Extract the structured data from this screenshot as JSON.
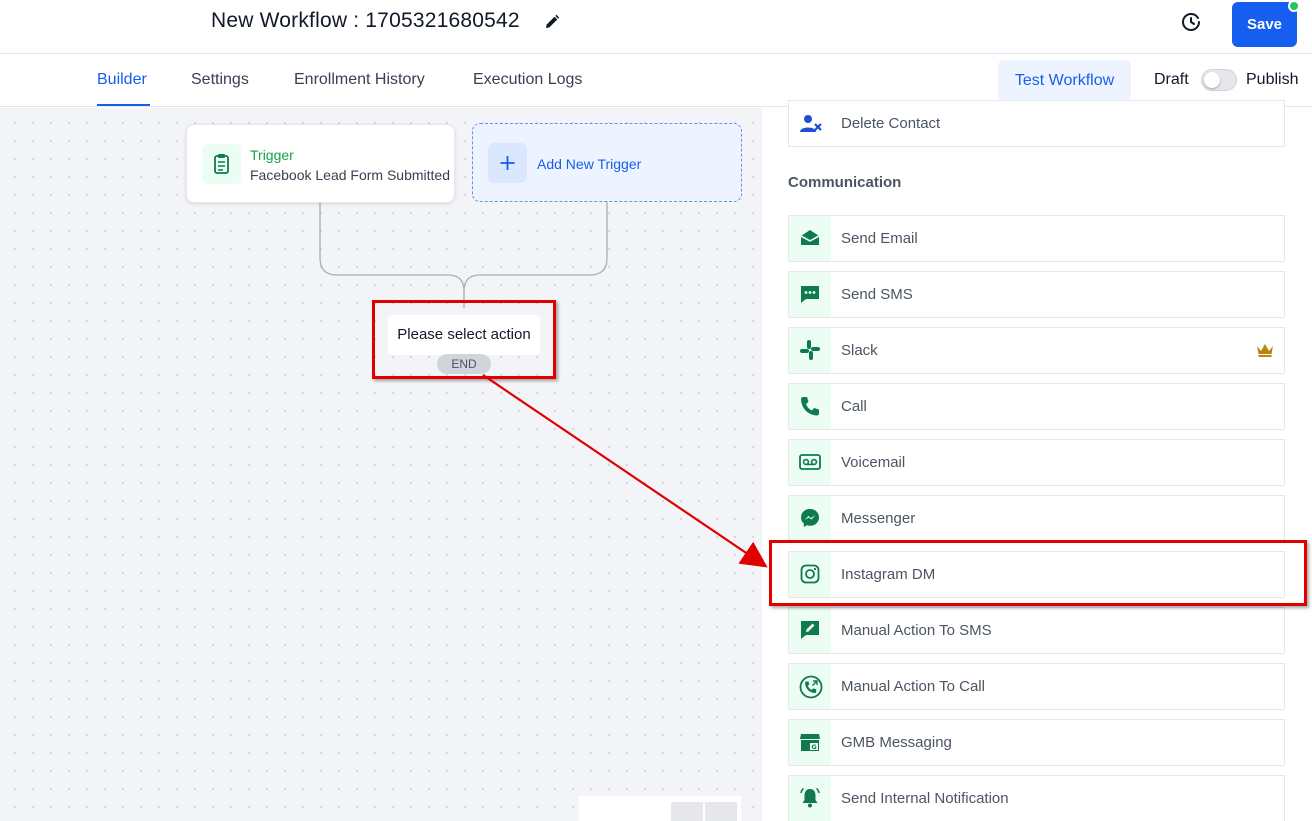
{
  "header": {
    "workflow_title": "New Workflow : 1705321680542",
    "save_label": "Save"
  },
  "tabs": [
    {
      "label": "Builder",
      "active": true
    },
    {
      "label": "Settings"
    },
    {
      "label": "Enrollment History"
    },
    {
      "label": "Execution Logs"
    }
  ],
  "toolbar": {
    "test_label": "Test Workflow",
    "draft_label": "Draft",
    "publish_label": "Publish",
    "published": false
  },
  "canvas": {
    "trigger_title": "Trigger",
    "trigger_subtitle": "Facebook Lead Form Submitted",
    "add_trigger_label": "Add New Trigger",
    "select_action_label": "Please select action",
    "end_label": "END"
  },
  "panel": {
    "top_item": {
      "label": "Delete Contact",
      "icon": "user-x-icon"
    },
    "section_title": "Communication",
    "actions": [
      {
        "label": "Send Email",
        "icon": "envelope-icon"
      },
      {
        "label": "Send SMS",
        "icon": "sms-bubble-icon"
      },
      {
        "label": "Slack",
        "icon": "slack-icon",
        "premium": true
      },
      {
        "label": "Call",
        "icon": "phone-icon"
      },
      {
        "label": "Voicemail",
        "icon": "voicemail-icon"
      },
      {
        "label": "Messenger",
        "icon": "messenger-icon"
      },
      {
        "label": "Instagram DM",
        "icon": "instagram-icon"
      },
      {
        "label": "Manual Action To SMS",
        "icon": "manual-sms-icon"
      },
      {
        "label": "Manual Action To Call",
        "icon": "manual-call-icon"
      },
      {
        "label": "GMB Messaging",
        "icon": "gmb-store-icon"
      },
      {
        "label": "Send Internal Notification",
        "icon": "bell-icon"
      }
    ]
  },
  "colors": {
    "accent": "#155eef",
    "icon_green": "#0f7a4d",
    "annotation_red": "#e00000",
    "premium_gold": "#b8860b"
  }
}
